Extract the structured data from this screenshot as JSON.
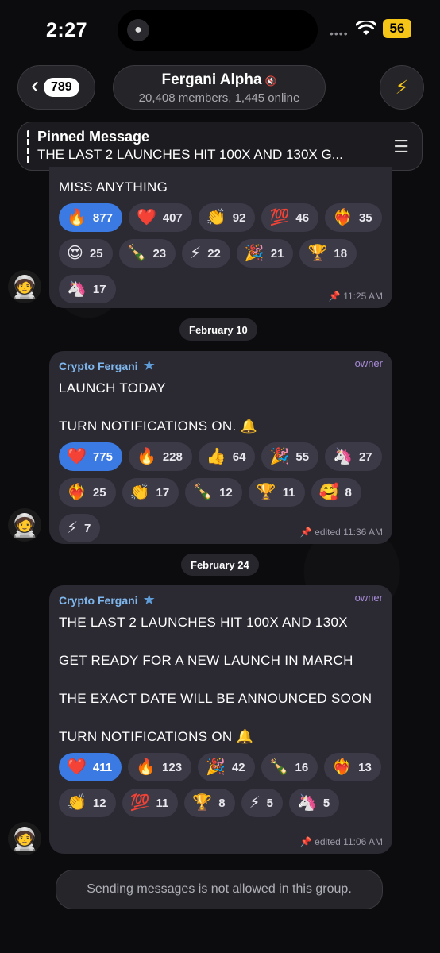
{
  "status_bar": {
    "time": "2:27",
    "battery": "56",
    "dots": "••••"
  },
  "header": {
    "back_count": "789",
    "title": "Fergani Alpha",
    "subtitle": "20,408 members, 1,445 online"
  },
  "pinned": {
    "title": "Pinned Message",
    "text": "THE LAST 2 LAUNCHES HIT 100X AND 130X G..."
  },
  "messages": [
    {
      "text_lines": [
        "MISS ANYTHING"
      ],
      "reactions": [
        {
          "emoji": "🔥",
          "count": "877",
          "active": true
        },
        {
          "emoji": "❤️",
          "count": "407"
        },
        {
          "emoji": "👏",
          "count": "92"
        },
        {
          "emoji": "💯",
          "count": "46"
        },
        {
          "emoji": "❤️‍🔥",
          "count": "35"
        },
        {
          "emoji": "😍",
          "count": "25"
        },
        {
          "emoji": "🍾",
          "count": "23"
        },
        {
          "emoji": "⚡",
          "count": "22"
        },
        {
          "emoji": "🎉",
          "count": "21"
        },
        {
          "emoji": "🏆",
          "count": "18"
        },
        {
          "emoji": "🦄",
          "count": "17"
        }
      ],
      "meta": "11:25 AM"
    },
    {
      "sender": "Crypto Fergani",
      "role": "owner",
      "text_lines": [
        "LAUNCH TODAY",
        "",
        "TURN NOTIFICATIONS ON. 🔔"
      ],
      "reactions": [
        {
          "emoji": "❤️",
          "count": "775",
          "active": true
        },
        {
          "emoji": "🔥",
          "count": "228"
        },
        {
          "emoji": "👍",
          "count": "64"
        },
        {
          "emoji": "🎉",
          "count": "55"
        },
        {
          "emoji": "🦄",
          "count": "27"
        },
        {
          "emoji": "❤️‍🔥",
          "count": "25"
        },
        {
          "emoji": "👏",
          "count": "17"
        },
        {
          "emoji": "🍾",
          "count": "12"
        },
        {
          "emoji": "🏆",
          "count": "11"
        },
        {
          "emoji": "🥰",
          "count": "8"
        },
        {
          "emoji": "⚡",
          "count": "7"
        }
      ],
      "meta": "edited 11:36 AM"
    },
    {
      "sender": "Crypto Fergani",
      "role": "owner",
      "text_lines": [
        "THE LAST 2 LAUNCHES HIT 100X AND 130X",
        "",
        "GET READY FOR A NEW LAUNCH IN MARCH",
        "",
        "THE EXACT DATE WILL BE ANNOUNCED SOON",
        "",
        "TURN NOTIFICATIONS ON 🔔"
      ],
      "reactions": [
        {
          "emoji": "❤️",
          "count": "411",
          "active": true
        },
        {
          "emoji": "🔥",
          "count": "123"
        },
        {
          "emoji": "🎉",
          "count": "42"
        },
        {
          "emoji": "🍾",
          "count": "16"
        },
        {
          "emoji": "❤️‍🔥",
          "count": "13"
        },
        {
          "emoji": "👏",
          "count": "12"
        },
        {
          "emoji": "💯",
          "count": "11"
        },
        {
          "emoji": "🏆",
          "count": "8"
        },
        {
          "emoji": "⚡",
          "count": "5"
        },
        {
          "emoji": "🦄",
          "count": "5"
        }
      ],
      "meta": "edited 11:06 AM"
    }
  ],
  "dates": [
    "February 10",
    "February 24"
  ],
  "footer": {
    "note": "Sending messages is not allowed in this group."
  }
}
